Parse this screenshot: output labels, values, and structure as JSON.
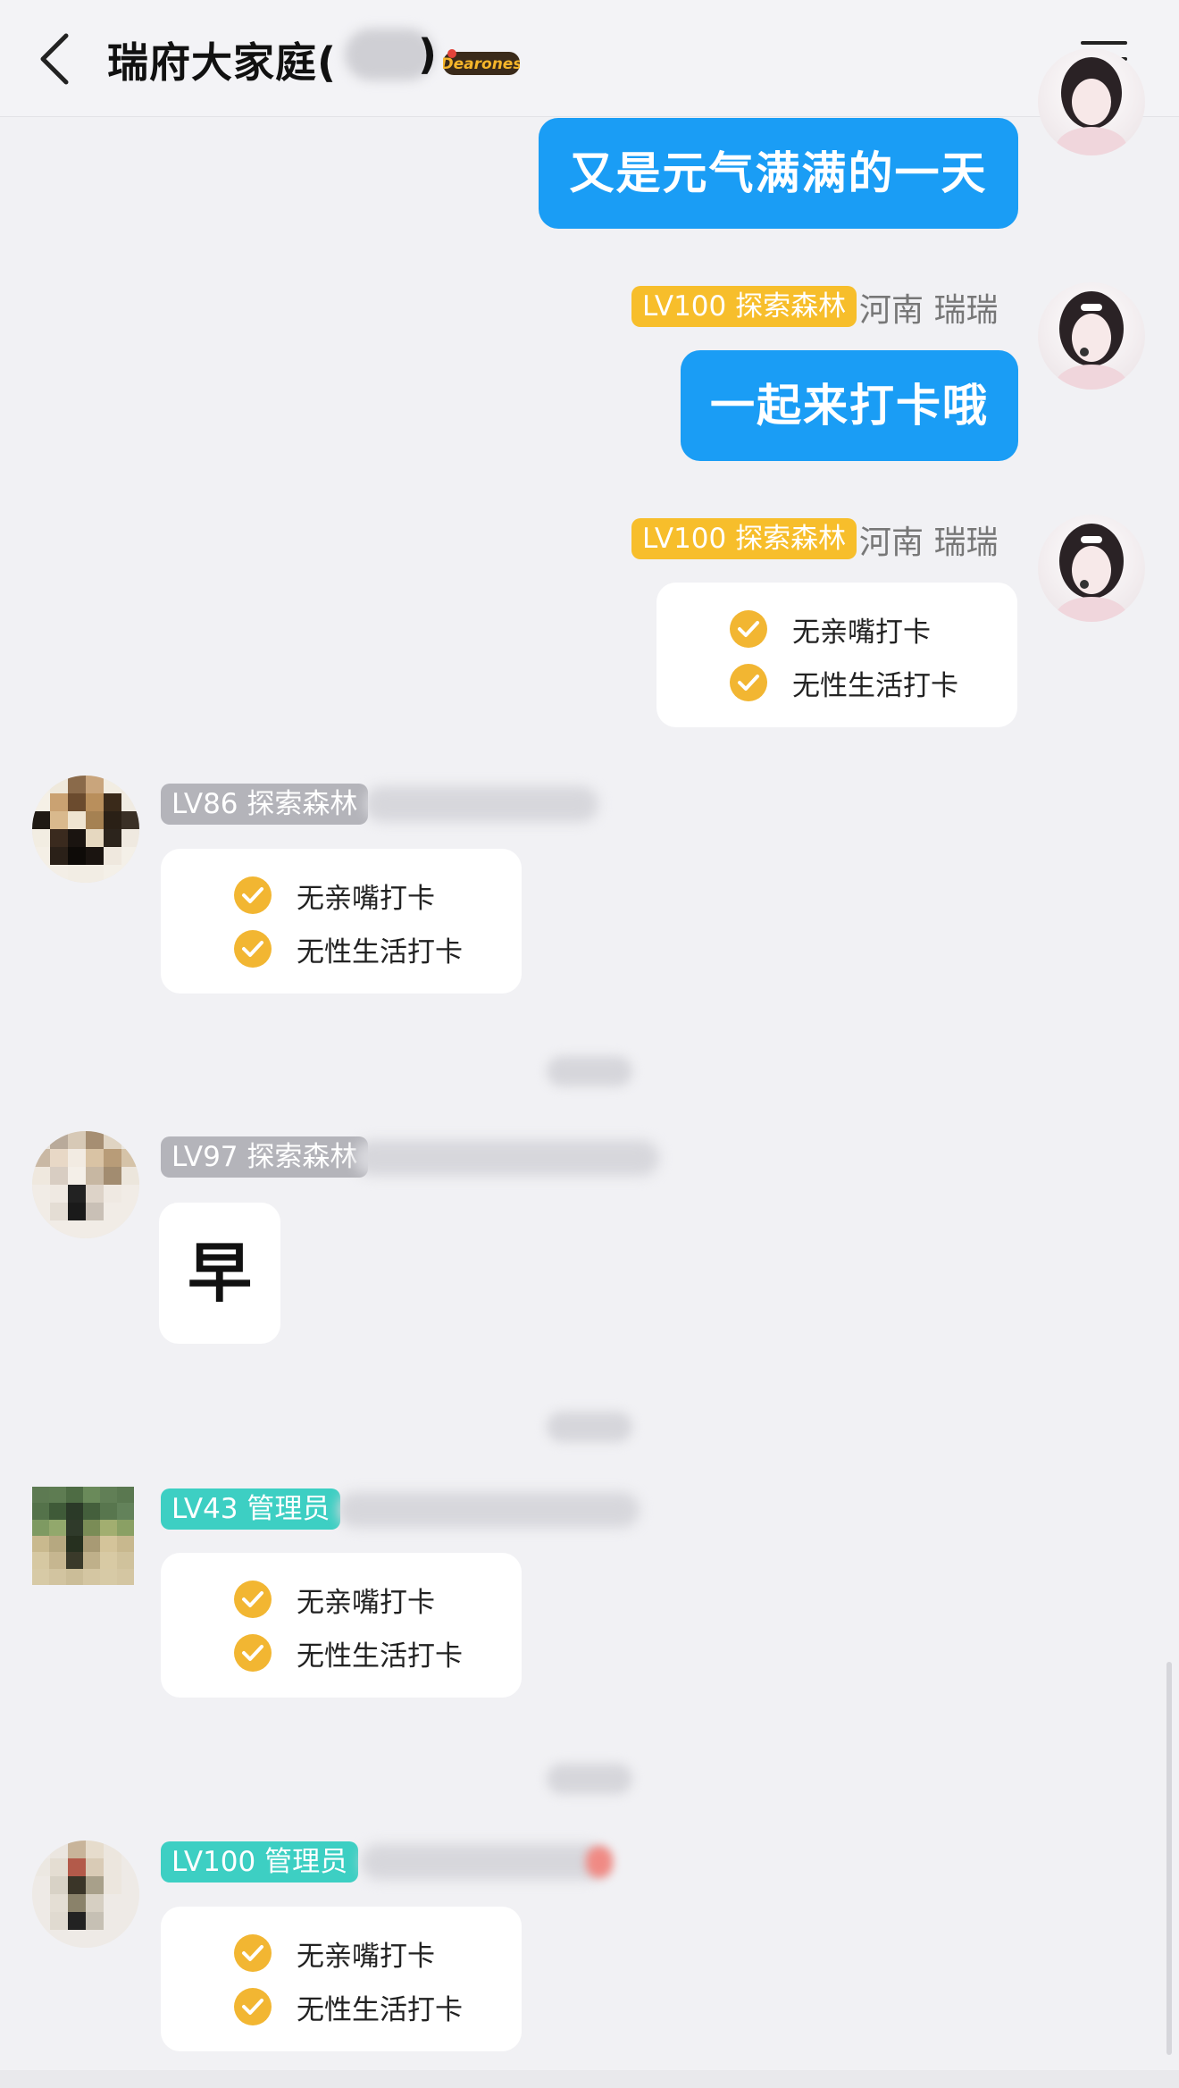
{
  "header": {
    "title": "瑞府大家庭(",
    "title_close": ")",
    "logo_text": "Dearones"
  },
  "messages": [
    {
      "side": "right",
      "text": "又是元气满满的一天"
    },
    {
      "side": "right",
      "tag": "LV100 探索森林",
      "sender": "河南 瑞瑞",
      "text": "一起来打卡哦"
    },
    {
      "side": "right",
      "tag": "LV100 探索森林",
      "sender": "河南 瑞瑞",
      "card": [
        "无亲嘴打卡",
        "无性生活打卡"
      ]
    },
    {
      "side": "left",
      "tag": "LV86 探索森林",
      "card": [
        "无亲嘴打卡",
        "无性生活打卡"
      ]
    },
    {
      "side": "left",
      "tag": "LV97 探索森林",
      "text": "早"
    },
    {
      "side": "left",
      "tag": "LV43 管理员",
      "card": [
        "无亲嘴打卡",
        "无性生活打卡"
      ]
    },
    {
      "side": "left",
      "tag": "LV100 管理员",
      "card": [
        "无亲嘴打卡",
        "无性生活打卡"
      ]
    }
  ],
  "colors": {
    "accent_blue": "#1a9df5",
    "tag_gold": "#f7be2b",
    "tag_gray": "#b4b4ba",
    "tag_teal": "#3dcfc3",
    "check_gold": "#f2b632",
    "background": "#f1f1f4"
  },
  "icons": [
    "back-chevron-icon",
    "menu-icon",
    "check-circle-icon"
  ]
}
